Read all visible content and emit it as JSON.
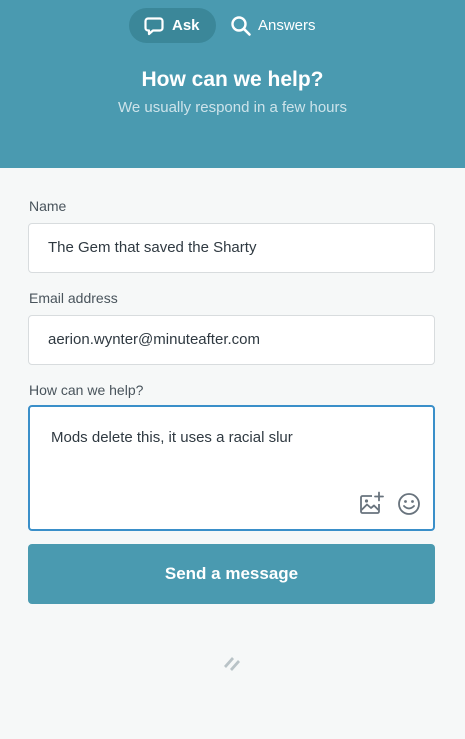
{
  "header": {
    "tabs": [
      {
        "label": "Ask",
        "icon": "speech-bubble-icon",
        "active": true
      },
      {
        "label": "Answers",
        "icon": "search-icon",
        "active": false
      }
    ],
    "title": "How can we help?",
    "subtitle": "We usually respond in a few hours"
  },
  "form": {
    "name": {
      "label": "Name",
      "value": "The Gem that saved the Sharty"
    },
    "email": {
      "label": "Email address",
      "value": "aerion.wynter@minuteafter.com"
    },
    "message": {
      "label": "How can we help?",
      "value": "Mods delete this, it uses a racial slur"
    },
    "attach_icon": "image-plus-icon",
    "emoji_icon": "smiley-icon",
    "send_label": "Send a message"
  },
  "footer": {
    "logo_icon": "helpscout-logo-icon"
  },
  "colors": {
    "brand": "#4a9ab0",
    "brand_dark": "#3b8799",
    "focus_border": "#3a8fc9",
    "background": "#f6f8f8"
  }
}
